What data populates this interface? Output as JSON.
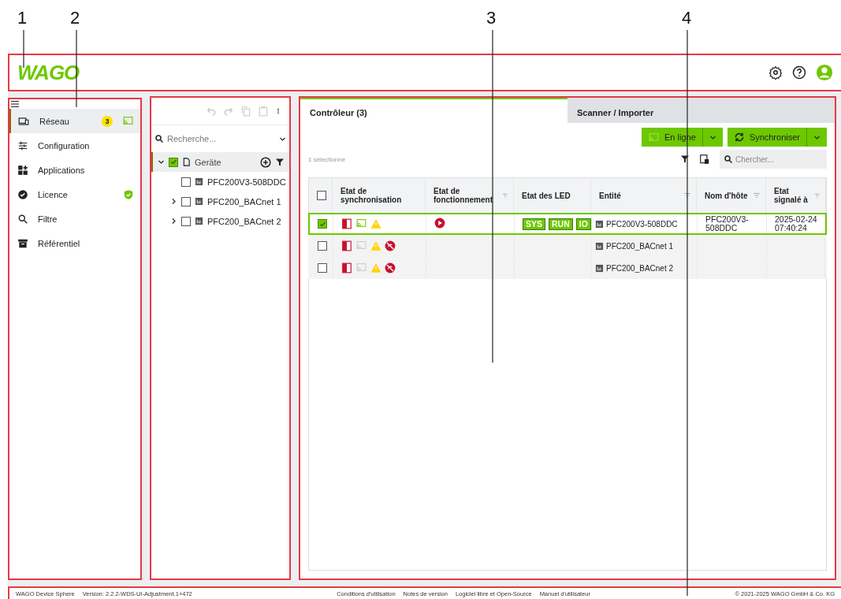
{
  "callouts": [
    "1",
    "2",
    "3",
    "4"
  ],
  "header": {
    "logo": "WAGO"
  },
  "sidebar": {
    "items": [
      {
        "label": "Réseau",
        "selected": true,
        "badge": "3"
      },
      {
        "label": "Configuration",
        "selected": false
      },
      {
        "label": "Applications",
        "selected": false
      },
      {
        "label": "Licence",
        "selected": false
      },
      {
        "label": "Filtre",
        "selected": false
      },
      {
        "label": "Référentiel",
        "selected": false
      }
    ]
  },
  "tree": {
    "search": {
      "placeholder": "Recherche..."
    },
    "root": {
      "label": "Geräte",
      "checked": true,
      "expanded": true,
      "selected": true,
      "children": [
        {
          "label": "PFC200V3-508DDC",
          "checked": false,
          "selected": false
        },
        {
          "label": "PFC200_BACnet 1",
          "checked": false,
          "expanded": false,
          "selected": false
        },
        {
          "label": "PFC200_BACnet 2",
          "checked": false,
          "expanded": false,
          "selected": false
        }
      ]
    }
  },
  "tabs": [
    {
      "label": "Contrôleur (3)",
      "selected": true
    },
    {
      "label": "Scanner / Importer",
      "selected": false
    }
  ],
  "actions": [
    "En ligne",
    "Synchroniser"
  ],
  "selection_count": "1 sélectionné",
  "search": {
    "placeholder": "Chercher..."
  },
  "table": {
    "select_all": {
      "checked": false
    },
    "columns": [
      {
        "label": "Etat de synchronisation",
        "filter": false
      },
      {
        "label": "Etat de fonctionnement",
        "filter": true
      },
      {
        "label": "Etat des LED",
        "filter": false
      },
      {
        "label": "Entité",
        "filter": true
      },
      {
        "label": "Nom d'hôte",
        "filter": true
      },
      {
        "label": "Etat signalé à",
        "filter": true
      }
    ],
    "rows": [
      {
        "selected": true,
        "checked": true,
        "online": true,
        "running": true,
        "leds": [
          "SYS",
          "RUN",
          "IO"
        ],
        "entity": "PFC200V3-508DDC",
        "hostname": "PFC200V3-508DDC",
        "reported": "2025-02-24 07:40:24"
      },
      {
        "selected": false,
        "checked": false,
        "online": false,
        "running": false,
        "leds": [],
        "entity": "PFC200_BACnet 1"
      },
      {
        "selected": false,
        "checked": false,
        "online": false,
        "running": false,
        "leds": [],
        "entity": "PFC200_BACnet 2"
      }
    ]
  },
  "footer": {
    "product": "WAGO Device Sphere",
    "version": "Version: 2.2.2-WDS-UI-Adjustment.1+472",
    "links": [
      "Conditions d'utilisation",
      "Notes de version",
      "Logiciel libre et Open-Source",
      "Manuel d'utilisateur"
    ],
    "copyright": "© 2021-2025 WAGO GmbH & Co. KG"
  }
}
